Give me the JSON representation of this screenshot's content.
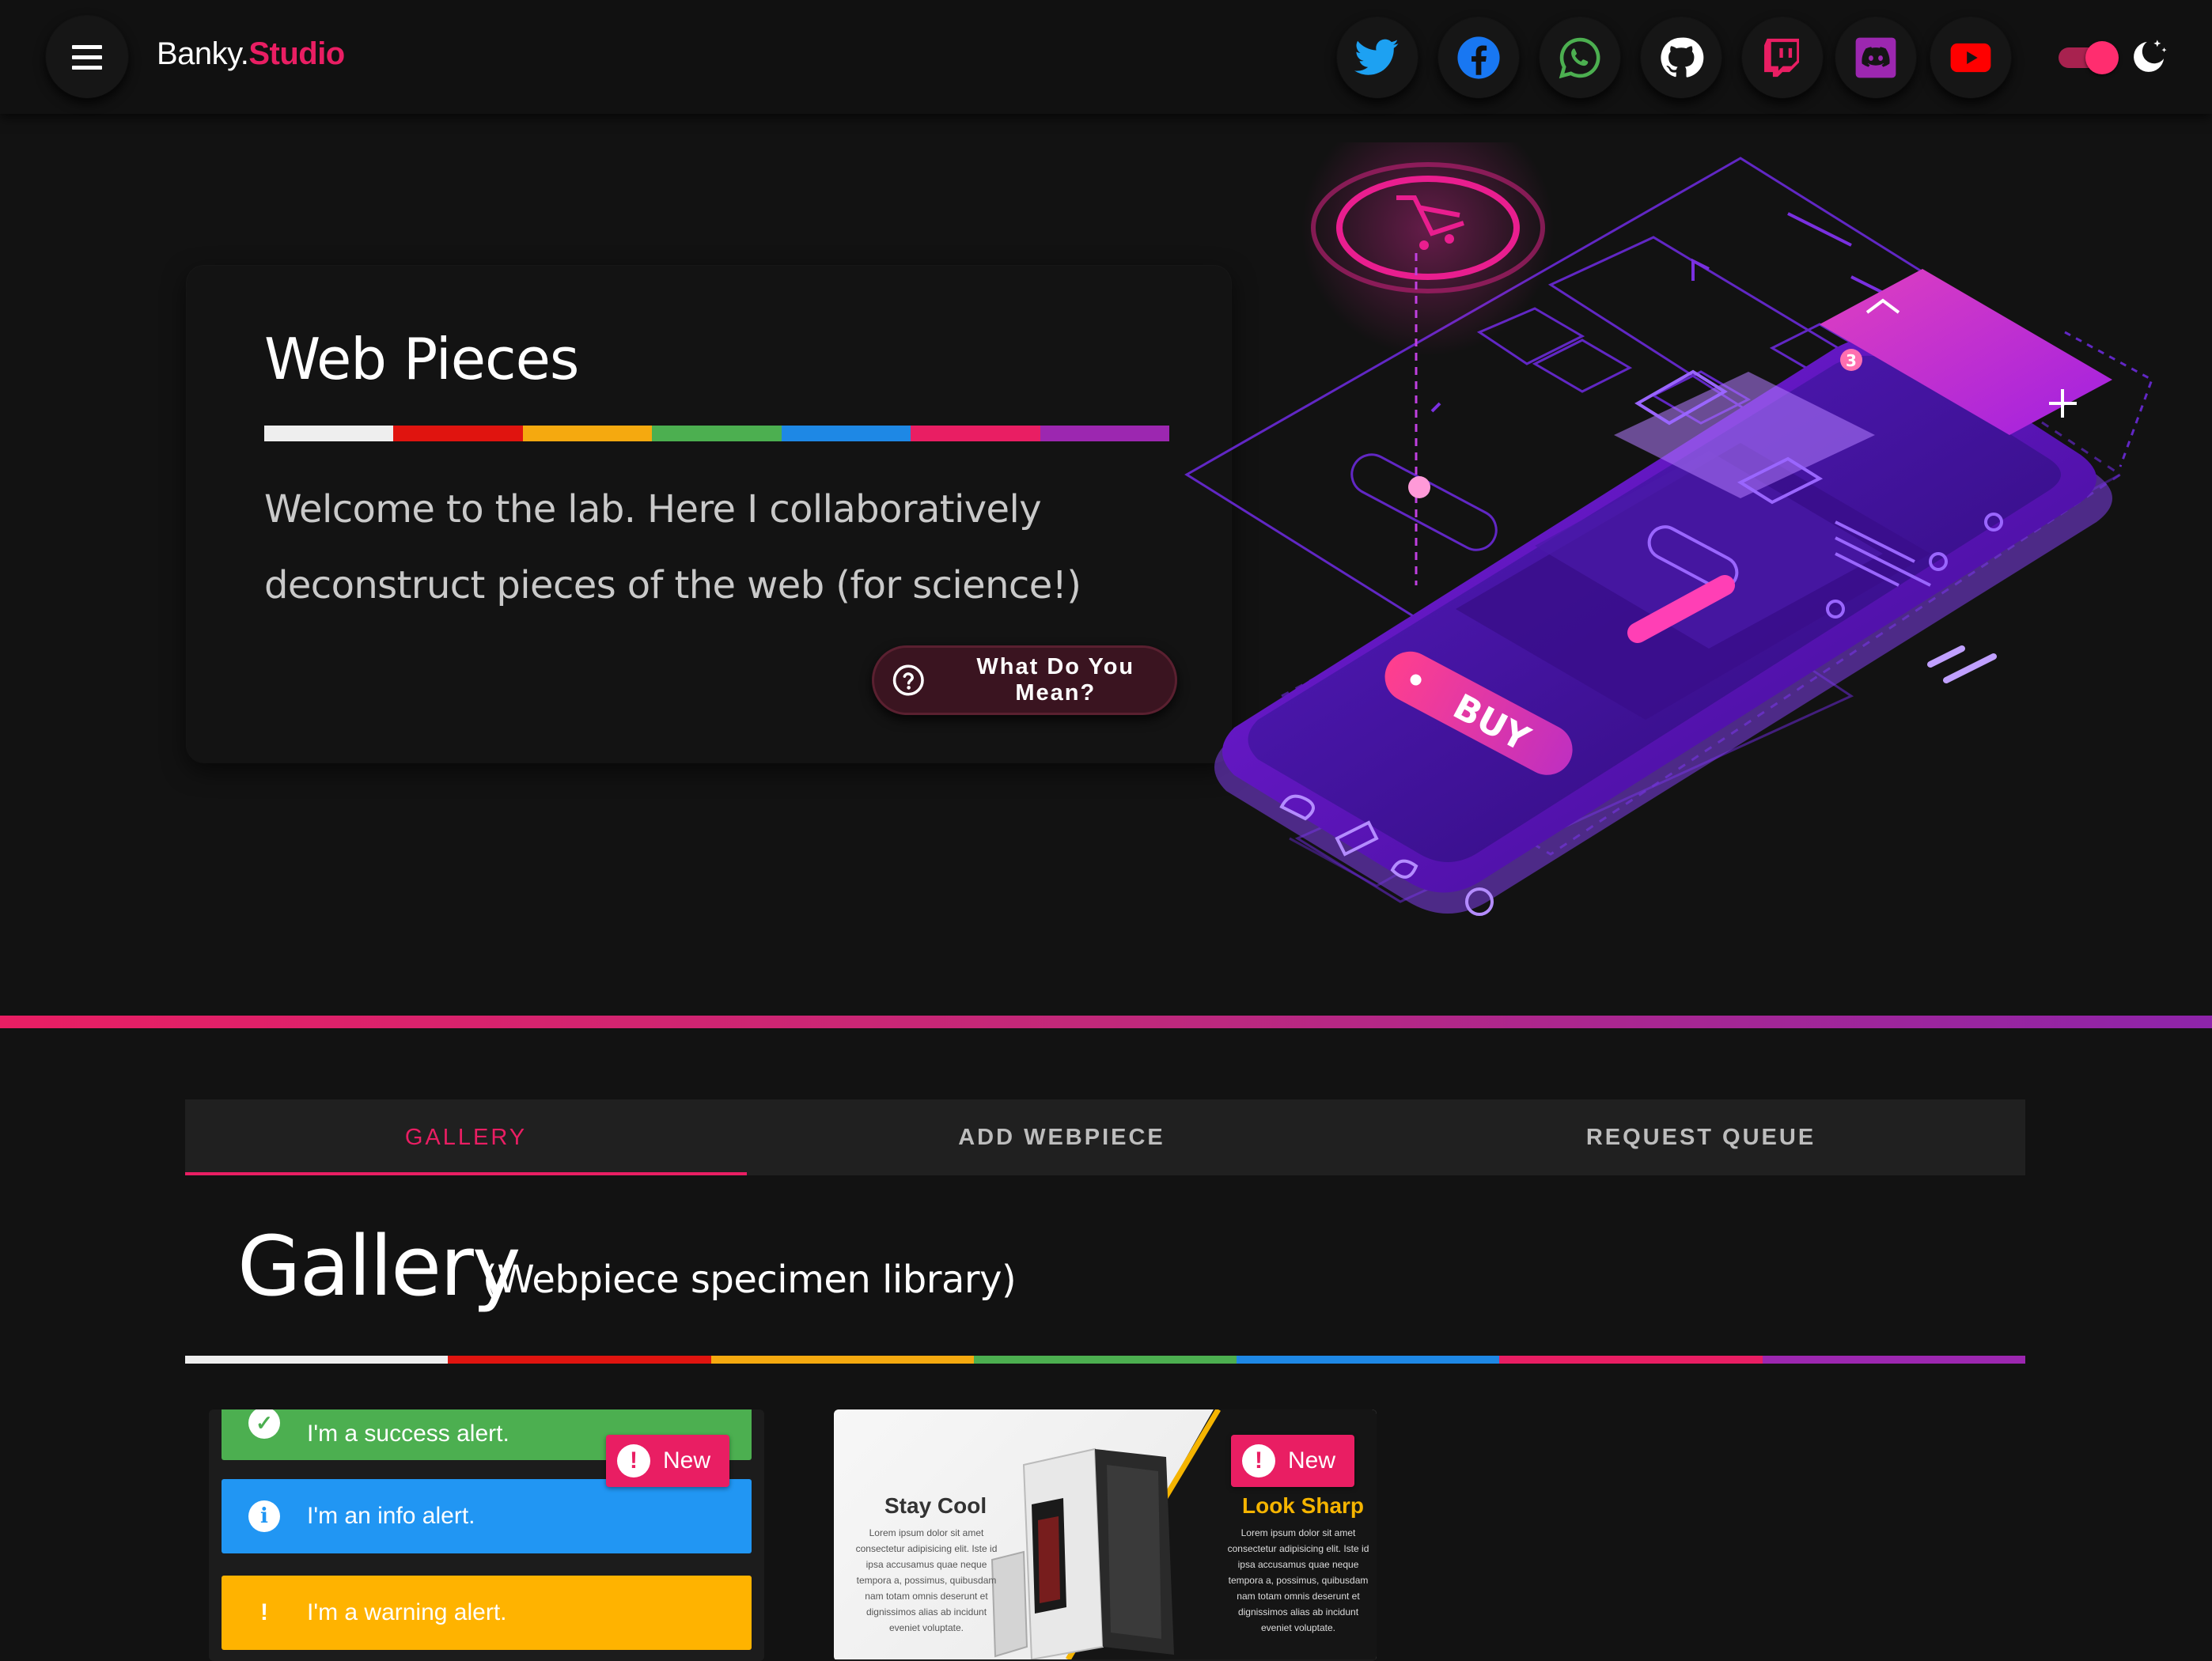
{
  "header": {
    "brand_part1": "Banky.",
    "brand_part2": "Studio",
    "menu_icon": "hamburger-menu-icon",
    "social_links": [
      {
        "name": "twitter",
        "icon": "twitter-icon",
        "color": "#1da1f2"
      },
      {
        "name": "facebook",
        "icon": "facebook-icon",
        "color": "#1877f2"
      },
      {
        "name": "whatsapp",
        "icon": "whatsapp-icon",
        "color": "#4caf50"
      },
      {
        "name": "github",
        "icon": "github-icon",
        "color": "#ffffff"
      },
      {
        "name": "twitch",
        "icon": "twitch-icon",
        "color": "#e91e63"
      },
      {
        "name": "discord",
        "icon": "discord-icon",
        "color": "#9c27b0"
      },
      {
        "name": "youtube",
        "icon": "youtube-icon",
        "color": "#ff0000"
      }
    ],
    "theme_toggle": {
      "state": "on",
      "icon": "moon-stars-icon"
    }
  },
  "hero": {
    "title": "Web Pieces",
    "text": "Welcome to the lab. Here I collaboratively deconstruct pieces of the web (for science!)",
    "button_label": "What Do You Mean?",
    "button_icon": "help-circle-icon",
    "illustration_labels": {
      "buy": "BUY",
      "cart_count": "3"
    }
  },
  "stripe_colors": [
    "#eeeeee",
    "#e0140f",
    "#f5a90f",
    "#4caf50",
    "#1e88e5",
    "#e91e63",
    "#9c27b0"
  ],
  "accent_color": "#e91e63",
  "tabs": [
    {
      "label": "GALLERY",
      "active": true
    },
    {
      "label": "ADD WEBPIECE",
      "active": false
    },
    {
      "label": "REQUEST QUEUE",
      "active": false
    }
  ],
  "gallery": {
    "title": "Gallery",
    "subtitle": "(Webpiece specimen library)",
    "cards": [
      {
        "badge": "New",
        "alerts": [
          {
            "text": "I'm a success alert.",
            "color": "#4caf50",
            "icon": "check-circle-icon"
          },
          {
            "text": "I'm an info alert.",
            "color": "#2196f3",
            "icon": "info-circle-icon"
          },
          {
            "text": "I'm a warning alert.",
            "color": "#ffb300",
            "icon": "warning-icon"
          }
        ]
      },
      {
        "badge": "New",
        "left_heading": "Stay Cool",
        "right_heading": "Look Sharp",
        "body": "Lorem ipsum dolor sit amet consectetur adipisicing elit. Iste id ipsa accusamus quae neque tempora a, possimus, quibusdam nam totam omnis deserunt et dignissimos alias ab incidunt eveniet voluptate."
      }
    ]
  }
}
